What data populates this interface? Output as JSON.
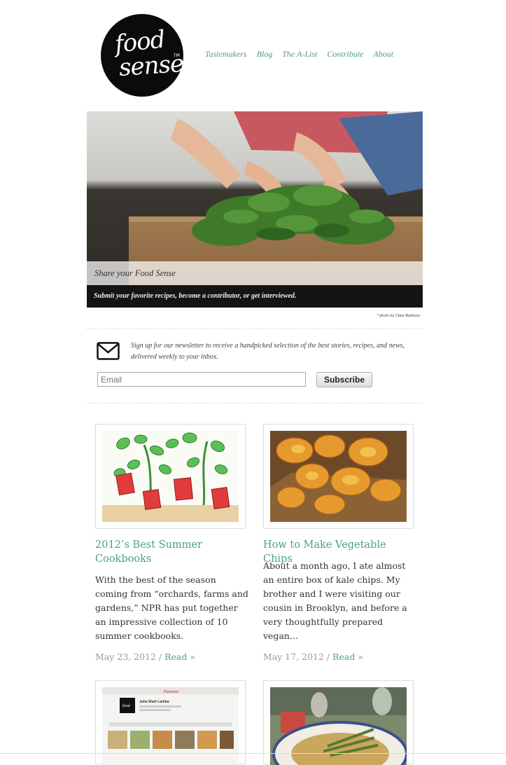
{
  "logo": {
    "line1": "food",
    "line2": "sense",
    "tm": "TM"
  },
  "nav": [
    "Tastemakers",
    "Blog",
    "The A-List",
    "Contribute",
    "About"
  ],
  "hero": {
    "title": "Share your Food Sense",
    "subtitle": "Submit your favorite recipes, become a contributor, or get interviewed.",
    "credit": "* photo by Clare Barboza"
  },
  "newsletter": {
    "icon": "envelope-icon",
    "text": "Sign up for our newsletter to receive a handpicked selection of the best stories, recipes, and news, delivered weekly to your inbox.",
    "email_placeholder": "Email",
    "button": "Subscribe"
  },
  "posts": [
    {
      "title": "2012’s Best Summer Cookbooks",
      "excerpt": "With the best of the season coming from “orchards, farms and gardens,” NPR has put together an impressive collection of 10 summer cookbooks.",
      "date": "May 23, 2012",
      "read": "Read »"
    },
    {
      "title": "How to Make Vegetable Chips",
      "excerpt": "About a month ago, I ate almost an entire box of kale chips. My brother and I were visiting our cousin in Brooklyn, and before a very thoughtfully prepared vegan...",
      "date": "May 17, 2012",
      "read": "Read »"
    }
  ],
  "thumb_pinterest": {
    "brand": "Pinterest",
    "name": "Julia Shah Lamba"
  },
  "colors": {
    "accent": "#4d9c8c",
    "caption_bar": "#141414",
    "logo_bg": "#0b0b0b"
  }
}
